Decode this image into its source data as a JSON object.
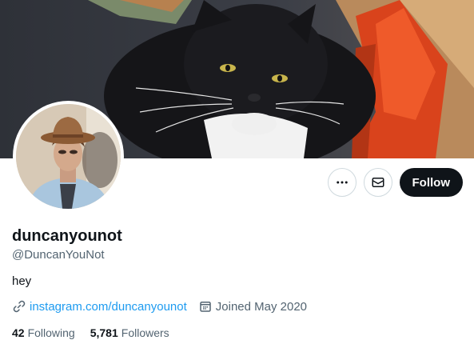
{
  "profile": {
    "display_name": "duncanyounot",
    "handle": "@DuncanYouNot",
    "bio": "hey",
    "website": "instagram.com/duncanyounot",
    "joined": "Joined May 2020"
  },
  "stats": {
    "following_count": "42",
    "following_label": "Following",
    "followers_count": "5,781",
    "followers_label": "Followers"
  },
  "actions": {
    "follow_label": "Follow",
    "more_icon": "more-horizontal-icon",
    "message_icon": "envelope-icon"
  },
  "colors": {
    "link": "#1d9bf0",
    "follow_bg": "#0f1419",
    "secondary_text": "#536471"
  }
}
